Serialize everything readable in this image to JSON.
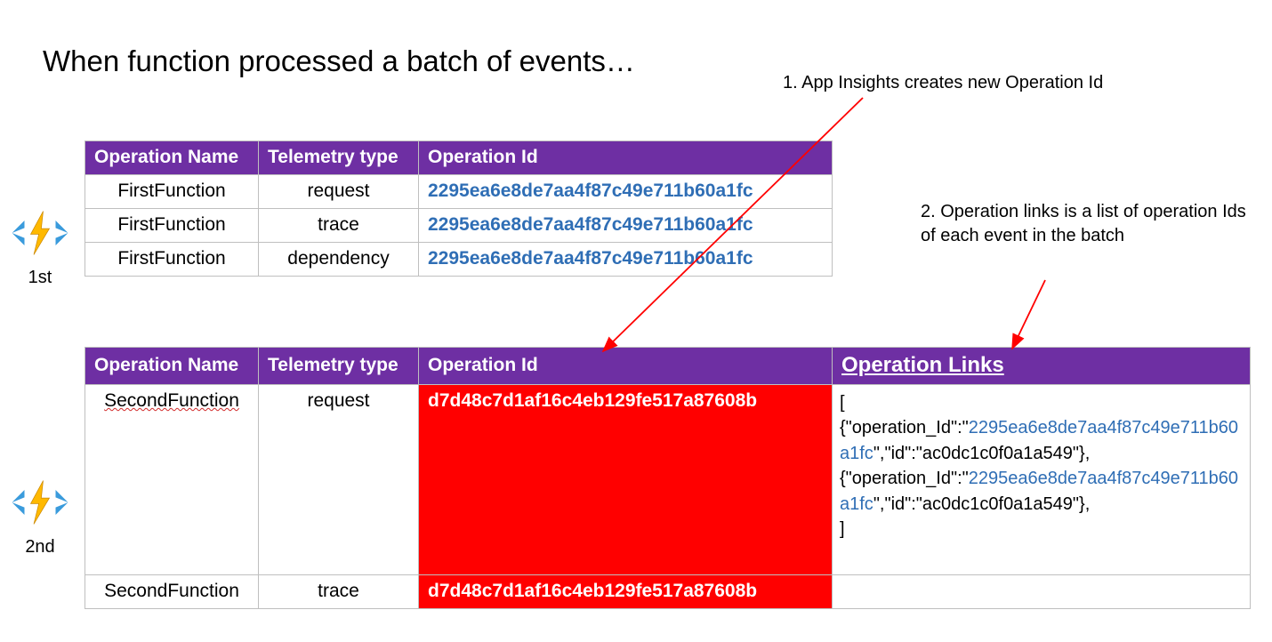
{
  "title": "When function processed a batch of events…",
  "annotations": {
    "a1": "1. App Insights creates new Operation Id",
    "a2": "2. Operation links is a list of operation Ids of each event in the batch"
  },
  "icons": {
    "label1": "1st",
    "label2": "2nd"
  },
  "table1": {
    "headers": {
      "op_name": "Operation Name",
      "tel_type": "Telemetry type",
      "op_id": "Operation Id"
    },
    "rows": [
      {
        "op_name": "FirstFunction",
        "tel_type": "request",
        "op_id": "2295ea6e8de7aa4f87c49e711b60a1fc"
      },
      {
        "op_name": "FirstFunction",
        "tel_type": "trace",
        "op_id": "2295ea6e8de7aa4f87c49e711b60a1fc"
      },
      {
        "op_name": "FirstFunction",
        "tel_type": "dependency",
        "op_id": "2295ea6e8de7aa4f87c49e711b60a1fc"
      }
    ]
  },
  "table2": {
    "headers": {
      "op_name": "Operation Name",
      "tel_type": "Telemetry type",
      "op_id": "Operation Id",
      "op_links": "Operation Links"
    },
    "rows": [
      {
        "op_name": "SecondFunction",
        "tel_type": "request",
        "op_id": "d7d48c7d1af16c4eb129fe517a87608b"
      },
      {
        "op_name": "SecondFunction",
        "tel_type": "trace",
        "op_id": "d7d48c7d1af16c4eb129fe517a87608b"
      }
    ],
    "links": {
      "open": "[",
      "frag1a": "{\"operation_Id\":\"",
      "id1": "2295ea6e8de7aa4f87c49e711b60a1fc",
      "frag1b": "\",\"id\":\"ac0dc1c0f0a1a549\"},",
      "frag2a": "{\"operation_Id\":\"",
      "id2": "2295ea6e8de7aa4f87c49e711b60a1fc",
      "frag2b": "\",\"id\":\"ac0dc1c0f0a1a549\"},",
      "close": "]"
    }
  }
}
